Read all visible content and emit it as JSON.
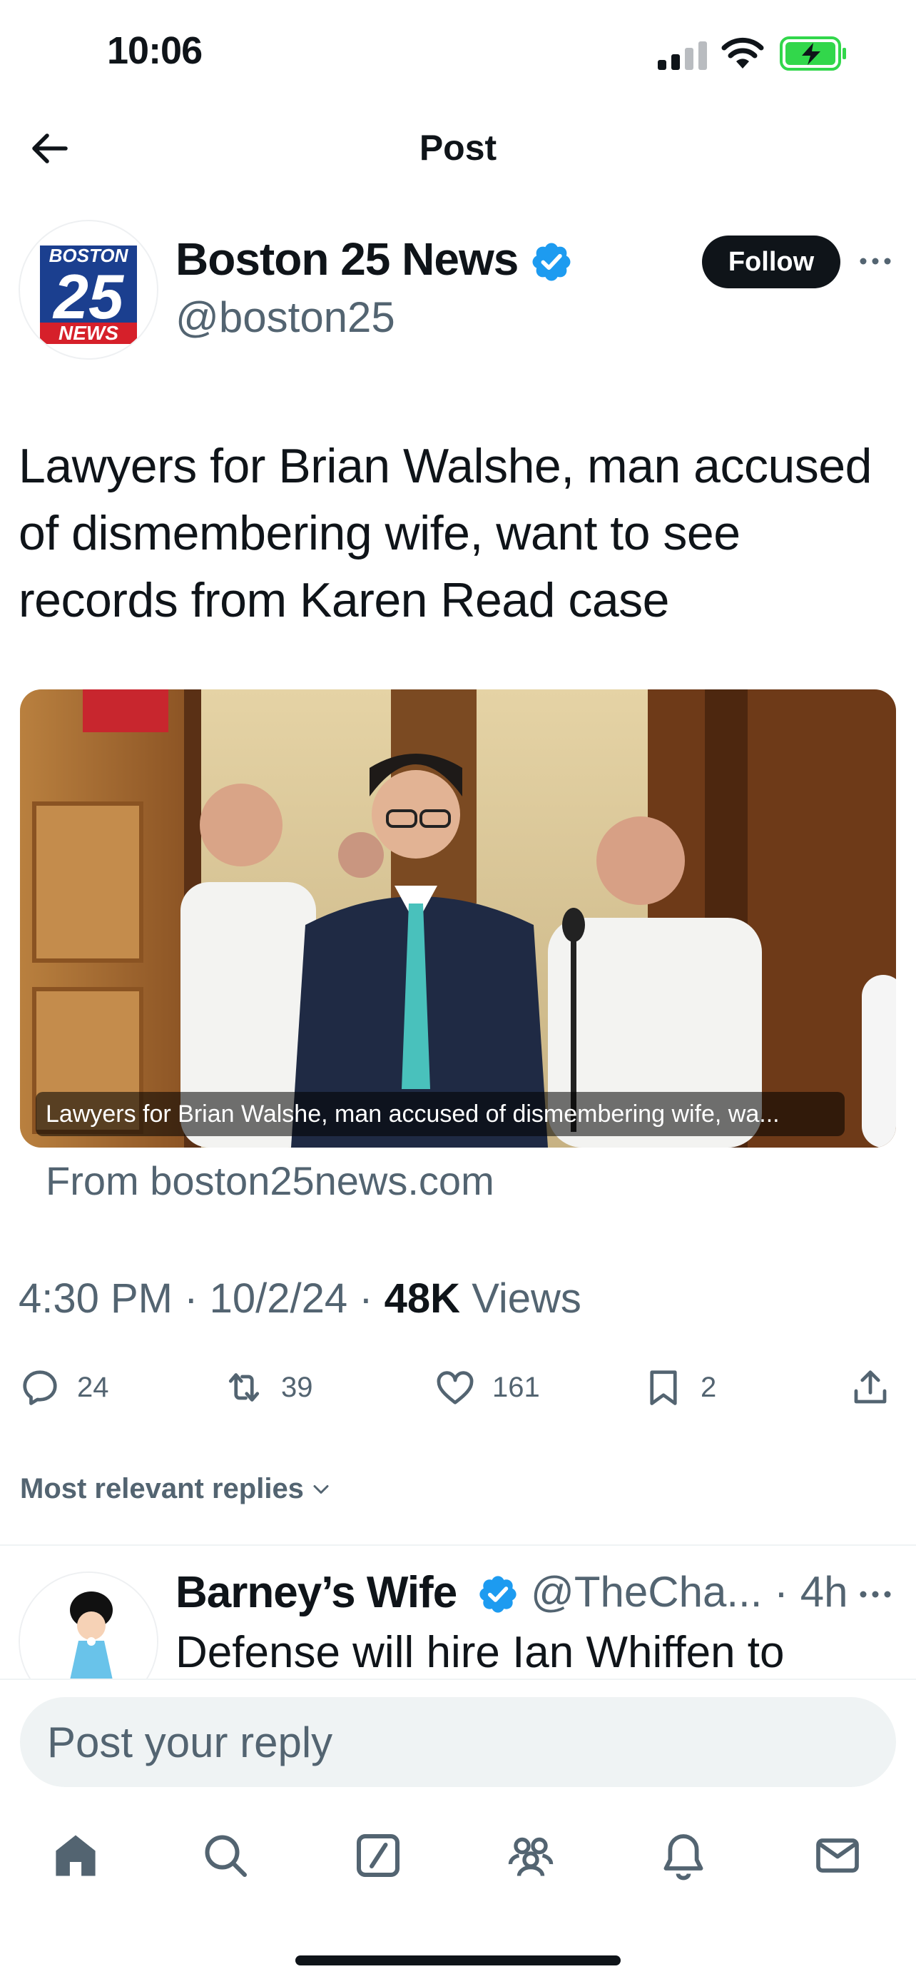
{
  "status_bar": {
    "time": "10:06"
  },
  "nav": {
    "title": "Post"
  },
  "author": {
    "name": "Boston 25 News",
    "handle": "@boston25",
    "logo_top": "BOSTON",
    "logo_number": "25",
    "logo_bottom": "NEWS",
    "follow_label": "Follow"
  },
  "post": {
    "text": "Lawyers for Brian Walshe, man accused of dismembering wife, want to see records from Karen Read case",
    "media_caption": "Lawyers for Brian Walshe, man accused of dismembering wife, wa...",
    "source_link": "From boston25news.com",
    "time": "4:30 PM",
    "date": "10/2/24",
    "views_count": "48K",
    "views_label": "Views",
    "separator": "·"
  },
  "actions": {
    "replies": "24",
    "reposts": "39",
    "likes": "161",
    "bookmarks": "2"
  },
  "replies_sort": {
    "label": "Most relevant replies"
  },
  "reply": {
    "name": "Barney’s Wife",
    "handle": "@TheCha... · 4h",
    "text": "Defense will hire Ian Whiffen to"
  },
  "composer": {
    "placeholder": "Post your reply"
  },
  "colors": {
    "accent_blue": "#1d9bf0",
    "text_primary": "#0f1419",
    "text_secondary": "#536471",
    "battery_green": "#32d74b"
  },
  "icons": {
    "tabs": [
      "home-icon",
      "search-icon",
      "grok-icon",
      "communities-icon",
      "notifications-icon",
      "messages-icon"
    ]
  }
}
